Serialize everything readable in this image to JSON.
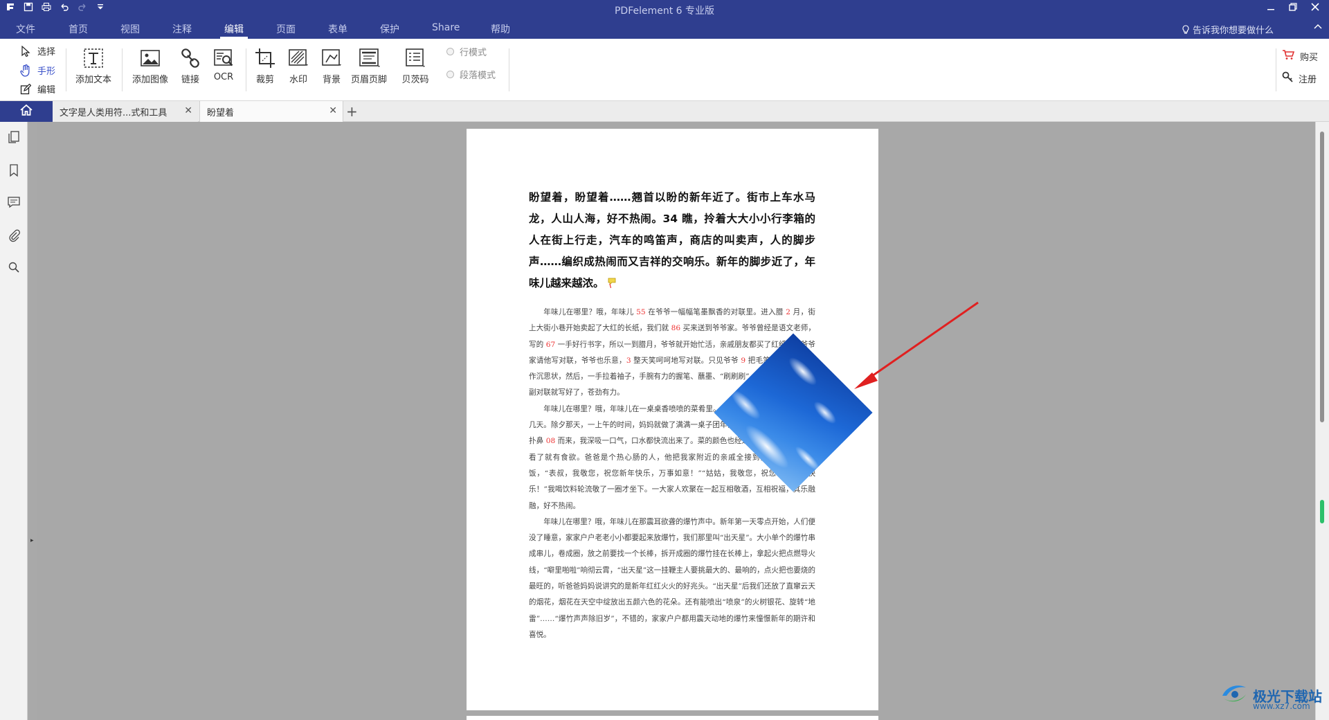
{
  "app": {
    "title": "PDFelement  6 专业版",
    "quick_access_icons": [
      "app-menu-icon",
      "save-icon",
      "print-icon",
      "undo-icon",
      "redo-icon",
      "customize-icon"
    ],
    "window_controls": [
      "minimize-icon",
      "maximize-icon",
      "close-icon"
    ]
  },
  "menu": {
    "items": [
      "文件",
      "首页",
      "视图",
      "注释",
      "编辑",
      "页面",
      "表单",
      "保护",
      "Share",
      "帮助"
    ],
    "active": "编辑",
    "tell_me": "告诉我你想要做什么"
  },
  "ribbon": {
    "modes": [
      {
        "label": "选择",
        "icon": "cursor-icon"
      },
      {
        "label": "手形",
        "icon": "hand-icon",
        "active": true
      },
      {
        "label": "编辑",
        "icon": "edit-icon"
      }
    ],
    "tools": [
      {
        "label": "添加文本",
        "icon": "add-text-icon"
      },
      {
        "label": "添加图像",
        "icon": "add-image-icon"
      },
      {
        "label": "链接",
        "icon": "link-icon"
      },
      {
        "label": "OCR",
        "icon": "ocr-icon"
      },
      {
        "label": "裁剪",
        "icon": "crop-icon"
      },
      {
        "label": "水印",
        "icon": "watermark-icon"
      },
      {
        "label": "背景",
        "icon": "background-icon"
      },
      {
        "label": "页眉页脚",
        "icon": "header-footer-icon"
      },
      {
        "label": "贝茨码",
        "icon": "bates-icon"
      }
    ],
    "radio_options": [
      "行模式",
      "段落模式"
    ],
    "right_buttons": [
      {
        "label": "购买",
        "icon": "cart-icon"
      },
      {
        "label": "注册",
        "icon": "key-icon"
      }
    ]
  },
  "tabs": [
    {
      "label": "文字是人类用符...式和工具"
    },
    {
      "label": "盼望着",
      "active": true
    }
  ],
  "sidebar": {
    "icons": [
      "thumbnails-icon",
      "bookmark-icon",
      "comment-icon",
      "attachment-icon",
      "search-icon"
    ]
  },
  "document": {
    "heading": "盼望着，盼望着……翘首以盼的新年近了。街市上车水马龙，人山人海，好不热闹。34 瞧，拎着大大小小行李箱的人在街上行走，汽车的鸣笛声，商店的叫卖声，人的脚步声……编织成热闹而又吉祥的交响乐。新年的脚步近了，年味儿越来越浓。",
    "paragraphs": [
      [
        {
          "t": "年味儿在哪里？哦，年味儿 "
        },
        {
          "t": "55",
          "n": true
        },
        {
          "t": " 在爷爷一幅幅笔墨飘香的对联里。进入腊 "
        },
        {
          "t": "2",
          "n": true
        },
        {
          "t": " 月，街上大街小巷开始卖起了大红的长纸，我们就 "
        },
        {
          "t": "86",
          "n": true
        },
        {
          "t": " 买来送到爷爷家。爷爷曾经是语文老师，写的 "
        },
        {
          "t": "67",
          "n": true
        },
        {
          "t": " 一手好行书字，所以一到腊月，爷爷就开始忙活，亲戚朋友都买了红纸拿到爷爷家请他写对联，爷爷也乐意，"
        },
        {
          "t": "3",
          "n": true
        },
        {
          "t": " 整天笑呵呵地写对联。只见爷爷 "
        },
        {
          "t": "9",
          "n": true
        },
        {
          "t": " 把毛笔杆头支着下巴作沉思状，然后，一手拉着袖子，手腕有力的握笔、蘸墨、“刷刷刷”，一会儿工夫，一副副对联就写好了，苍劲有力。"
        }
      ],
      [
        {
          "t": "年味儿在哪里？哦，年味儿在一桌桌香喷喷的菜肴里。为了过年的饭菜忙活了 "
        },
        {
          "t": "56",
          "n": true
        },
        {
          "t": " 好几天。除夕那天，一上午的时间，妈妈就做了满满一桌子团年饭，饭桌上热气腾腾，香气扑鼻 "
        },
        {
          "t": "08",
          "n": true
        },
        {
          "t": " 而来，我深吸一口气，口水都快流出来了。菜的颜色也经过妈妈细心搭配，让人看了就有食欲。爸爸是个热心肠的人，他把我家附近的亲戚全接到我家里来吃团年饭，“表叔，我敬您，祝您新年快乐，万事如意！”“姑姑，我敬您，祝您新年健康快乐！”我喝饮料轮流敬了一圈才坐下。一大家人欢聚在一起互相敬酒，互相祝福，其乐融融，好不热闹。"
        }
      ],
      [
        {
          "t": "年味儿在哪里？哦，年味儿在那震耳欲聋的爆竹声中。新年第一天零点开始，人们便没了睡意，家家户户老老小小都要起来放爆竹，我们那里叫“出天星”。大小单个的爆竹串成串儿，卷成圈，放之前要找一个长棒，拆开成圈的爆竹挂在长棒上，拿起火把点燃导火线，“噼里啪啦”响彻云霄，“出天星”这一挂鞭主人要挑最大的、最响的，点火把也要烧的最旺的，听爸爸妈妈说讲究的是新年红红火火的好兆头。“出天星”后我们还放了直窜云天的烟花，烟花在天空中绽放出五颜六色的花朵。还有能喷出“喷泉”的火树银花、旋转“地雷”……“爆竹声声除旧岁”，不错的，家家户户都用震天动地的爆竹来憧憬新年的期许和喜悦。"
        }
      ]
    ]
  },
  "watermark": {
    "text": "极光下载站",
    "url": "www.xz7.com"
  },
  "colors": {
    "brand": "#2f3e8f",
    "accent": "#3950c9",
    "number_red": "#e33333",
    "annotation_arrow": "#e02020"
  }
}
